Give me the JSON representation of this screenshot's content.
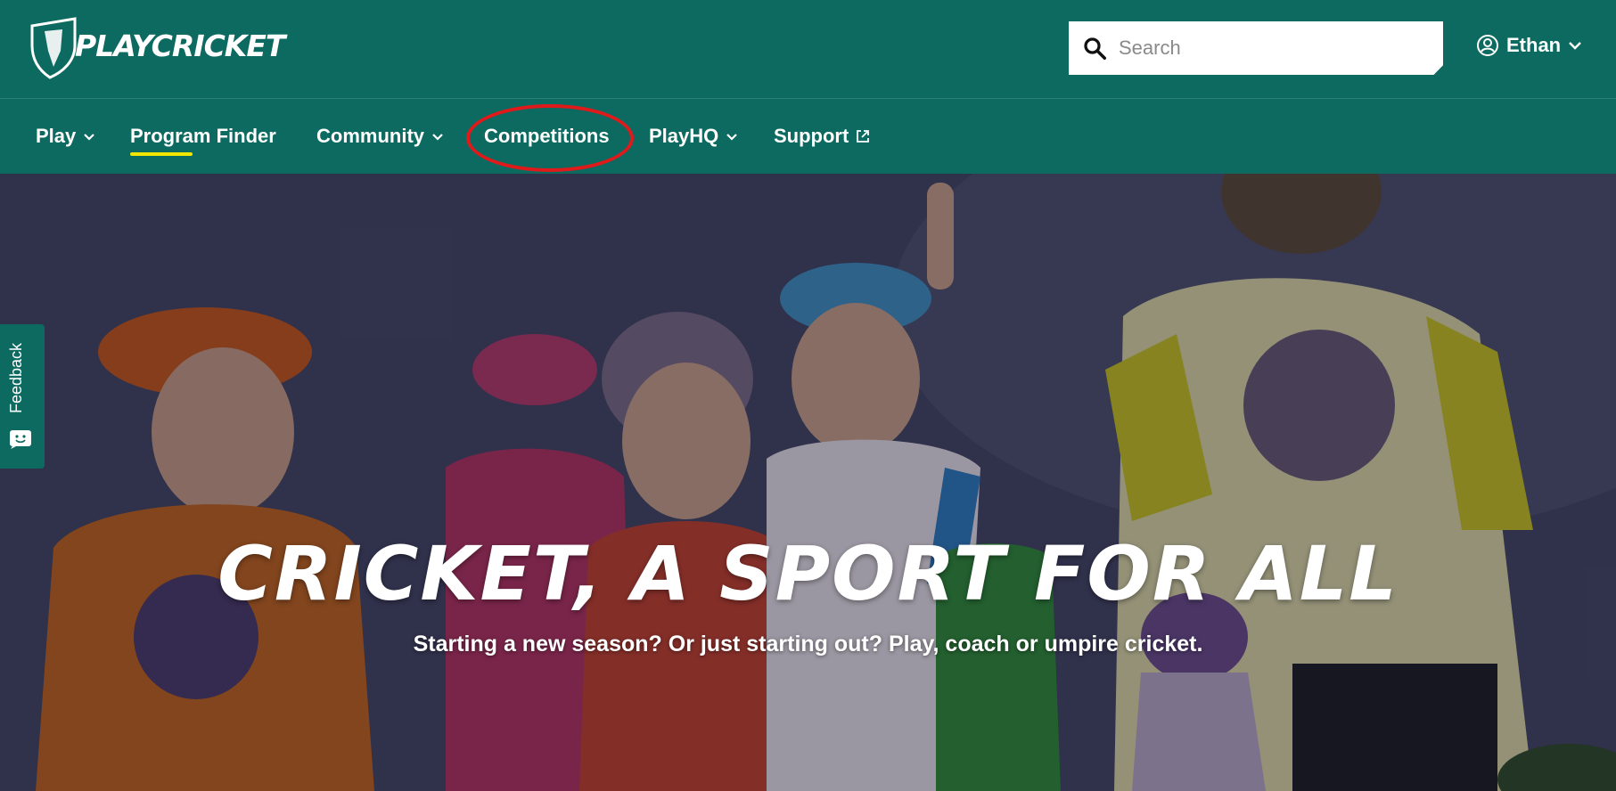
{
  "header": {
    "logo_text": "PLAYCRICKET",
    "search_placeholder": "Search",
    "user_name": "Ethan"
  },
  "nav": {
    "items": [
      {
        "label": "Play",
        "has_dropdown": true
      },
      {
        "label": "Program Finder",
        "active": true
      },
      {
        "label": "Community",
        "has_dropdown": true
      },
      {
        "label": "Competitions",
        "highlighted": true
      },
      {
        "label": "PlayHQ",
        "has_dropdown": true
      },
      {
        "label": "Support",
        "external": true
      }
    ]
  },
  "hero": {
    "title": "CRICKET, A SPORT FOR ALL",
    "subtitle": "Starting a new season? Or just starting out? Play, coach or umpire cricket."
  },
  "feedback": {
    "label": "Feedback"
  },
  "colors": {
    "brand": "#0c6a60",
    "accent": "#f3e600",
    "highlight": "#e01a1a"
  },
  "icons": [
    "shield-logo",
    "search-icon",
    "user-circle-icon",
    "chevron-down-icon",
    "external-link-icon",
    "feedback-face-icon"
  ]
}
